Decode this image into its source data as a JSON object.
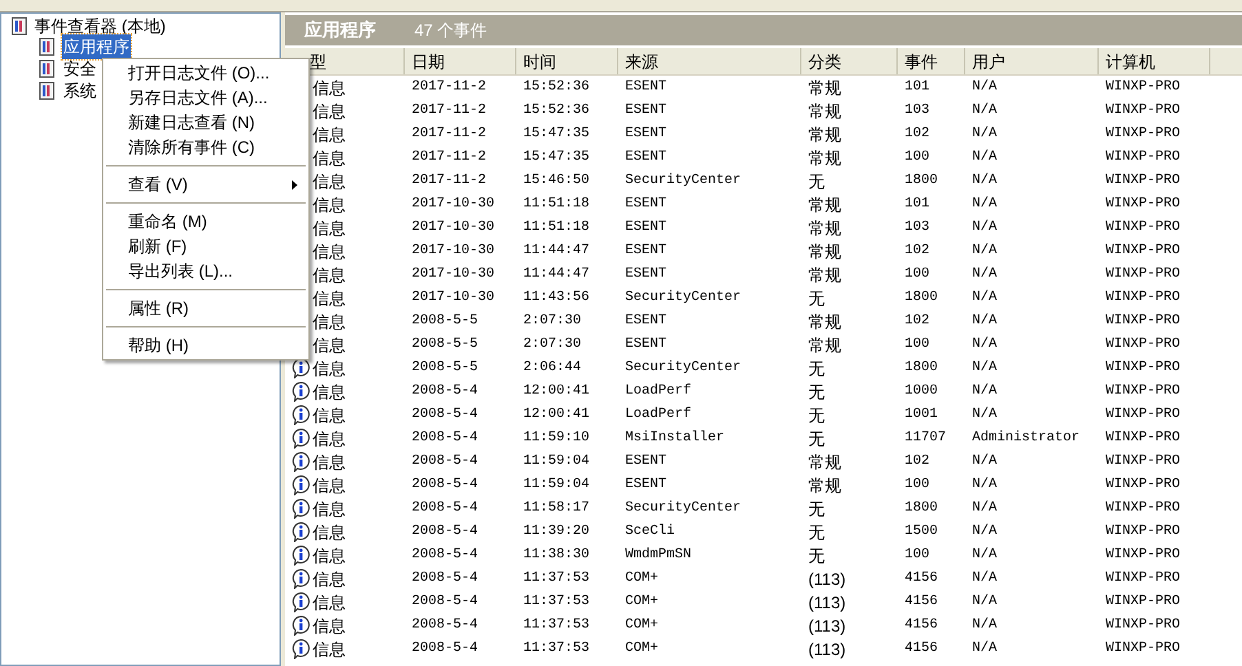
{
  "tree": {
    "root": {
      "label": "事件查看器 (本地)",
      "children": [
        {
          "label": "应用程序",
          "selected": true
        },
        {
          "label": "安全",
          "selected": false
        },
        {
          "label": "系统",
          "selected": false
        }
      ]
    }
  },
  "log_header": {
    "title": "应用程序",
    "count": "47 个事件"
  },
  "table": {
    "columns": [
      "型",
      "日期",
      "时间",
      "来源",
      "分类",
      "事件",
      "用户",
      "计算机"
    ],
    "rows": [
      {
        "type": "信息",
        "date": "2017-11-2",
        "time": "15:52:36",
        "source": "ESENT",
        "category": "常规",
        "event": "101",
        "user": "N/A",
        "computer": "WINXP-PRO"
      },
      {
        "type": "信息",
        "date": "2017-11-2",
        "time": "15:52:36",
        "source": "ESENT",
        "category": "常规",
        "event": "103",
        "user": "N/A",
        "computer": "WINXP-PRO"
      },
      {
        "type": "信息",
        "date": "2017-11-2",
        "time": "15:47:35",
        "source": "ESENT",
        "category": "常规",
        "event": "102",
        "user": "N/A",
        "computer": "WINXP-PRO"
      },
      {
        "type": "信息",
        "date": "2017-11-2",
        "time": "15:47:35",
        "source": "ESENT",
        "category": "常规",
        "event": "100",
        "user": "N/A",
        "computer": "WINXP-PRO"
      },
      {
        "type": "信息",
        "date": "2017-11-2",
        "time": "15:46:50",
        "source": "SecurityCenter",
        "category": "无",
        "event": "1800",
        "user": "N/A",
        "computer": "WINXP-PRO"
      },
      {
        "type": "信息",
        "date": "2017-10-30",
        "time": "11:51:18",
        "source": "ESENT",
        "category": "常规",
        "event": "101",
        "user": "N/A",
        "computer": "WINXP-PRO"
      },
      {
        "type": "信息",
        "date": "2017-10-30",
        "time": "11:51:18",
        "source": "ESENT",
        "category": "常规",
        "event": "103",
        "user": "N/A",
        "computer": "WINXP-PRO"
      },
      {
        "type": "信息",
        "date": "2017-10-30",
        "time": "11:44:47",
        "source": "ESENT",
        "category": "常规",
        "event": "102",
        "user": "N/A",
        "computer": "WINXP-PRO"
      },
      {
        "type": "信息",
        "date": "2017-10-30",
        "time": "11:44:47",
        "source": "ESENT",
        "category": "常规",
        "event": "100",
        "user": "N/A",
        "computer": "WINXP-PRO"
      },
      {
        "type": "信息",
        "date": "2017-10-30",
        "time": "11:43:56",
        "source": "SecurityCenter",
        "category": "无",
        "event": "1800",
        "user": "N/A",
        "computer": "WINXP-PRO"
      },
      {
        "type": "信息",
        "date": "2008-5-5",
        "time": "2:07:30",
        "source": "ESENT",
        "category": "常规",
        "event": "102",
        "user": "N/A",
        "computer": "WINXP-PRO"
      },
      {
        "type": "信息",
        "date": "2008-5-5",
        "time": "2:07:30",
        "source": "ESENT",
        "category": "常规",
        "event": "100",
        "user": "N/A",
        "computer": "WINXP-PRO"
      },
      {
        "type": "信息",
        "date": "2008-5-5",
        "time": "2:06:44",
        "source": "SecurityCenter",
        "category": "无",
        "event": "1800",
        "user": "N/A",
        "computer": "WINXP-PRO"
      },
      {
        "type": "信息",
        "date": "2008-5-4",
        "time": "12:00:41",
        "source": "LoadPerf",
        "category": "无",
        "event": "1000",
        "user": "N/A",
        "computer": "WINXP-PRO"
      },
      {
        "type": "信息",
        "date": "2008-5-4",
        "time": "12:00:41",
        "source": "LoadPerf",
        "category": "无",
        "event": "1001",
        "user": "N/A",
        "computer": "WINXP-PRO"
      },
      {
        "type": "信息",
        "date": "2008-5-4",
        "time": "11:59:10",
        "source": "MsiInstaller",
        "category": "无",
        "event": "11707",
        "user": "Administrator",
        "computer": "WINXP-PRO"
      },
      {
        "type": "信息",
        "date": "2008-5-4",
        "time": "11:59:04",
        "source": "ESENT",
        "category": "常规",
        "event": "102",
        "user": "N/A",
        "computer": "WINXP-PRO"
      },
      {
        "type": "信息",
        "date": "2008-5-4",
        "time": "11:59:04",
        "source": "ESENT",
        "category": "常规",
        "event": "100",
        "user": "N/A",
        "computer": "WINXP-PRO"
      },
      {
        "type": "信息",
        "date": "2008-5-4",
        "time": "11:58:17",
        "source": "SecurityCenter",
        "category": "无",
        "event": "1800",
        "user": "N/A",
        "computer": "WINXP-PRO"
      },
      {
        "type": "信息",
        "date": "2008-5-4",
        "time": "11:39:20",
        "source": "SceCli",
        "category": "无",
        "event": "1500",
        "user": "N/A",
        "computer": "WINXP-PRO"
      },
      {
        "type": "信息",
        "date": "2008-5-4",
        "time": "11:38:30",
        "source": "WmdmPmSN",
        "category": "无",
        "event": "100",
        "user": "N/A",
        "computer": "WINXP-PRO"
      },
      {
        "type": "信息",
        "date": "2008-5-4",
        "time": "11:37:53",
        "source": "COM+",
        "category": "(113)",
        "event": "4156",
        "user": "N/A",
        "computer": "WINXP-PRO"
      },
      {
        "type": "信息",
        "date": "2008-5-4",
        "time": "11:37:53",
        "source": "COM+",
        "category": "(113)",
        "event": "4156",
        "user": "N/A",
        "computer": "WINXP-PRO"
      },
      {
        "type": "信息",
        "date": "2008-5-4",
        "time": "11:37:53",
        "source": "COM+",
        "category": "(113)",
        "event": "4156",
        "user": "N/A",
        "computer": "WINXP-PRO"
      },
      {
        "type": "信息",
        "date": "2008-5-4",
        "time": "11:37:53",
        "source": "COM+",
        "category": "(113)",
        "event": "4156",
        "user": "N/A",
        "computer": "WINXP-PRO"
      }
    ]
  },
  "context_menu": {
    "items": [
      {
        "kind": "item",
        "label": "打开日志文件 (O)..."
      },
      {
        "kind": "item",
        "label": "另存日志文件 (A)..."
      },
      {
        "kind": "item",
        "label": "新建日志查看 (N)"
      },
      {
        "kind": "item",
        "label": "清除所有事件 (C)"
      },
      {
        "kind": "separator"
      },
      {
        "kind": "submenu",
        "label": "查看 (V)"
      },
      {
        "kind": "separator"
      },
      {
        "kind": "item",
        "label": "重命名 (M)"
      },
      {
        "kind": "item",
        "label": "刷新 (F)"
      },
      {
        "kind": "item",
        "label": "导出列表 (L)..."
      },
      {
        "kind": "separator"
      },
      {
        "kind": "item",
        "label": "属性 (R)"
      },
      {
        "kind": "separator"
      },
      {
        "kind": "item",
        "label": "帮助 (H)"
      }
    ]
  }
}
